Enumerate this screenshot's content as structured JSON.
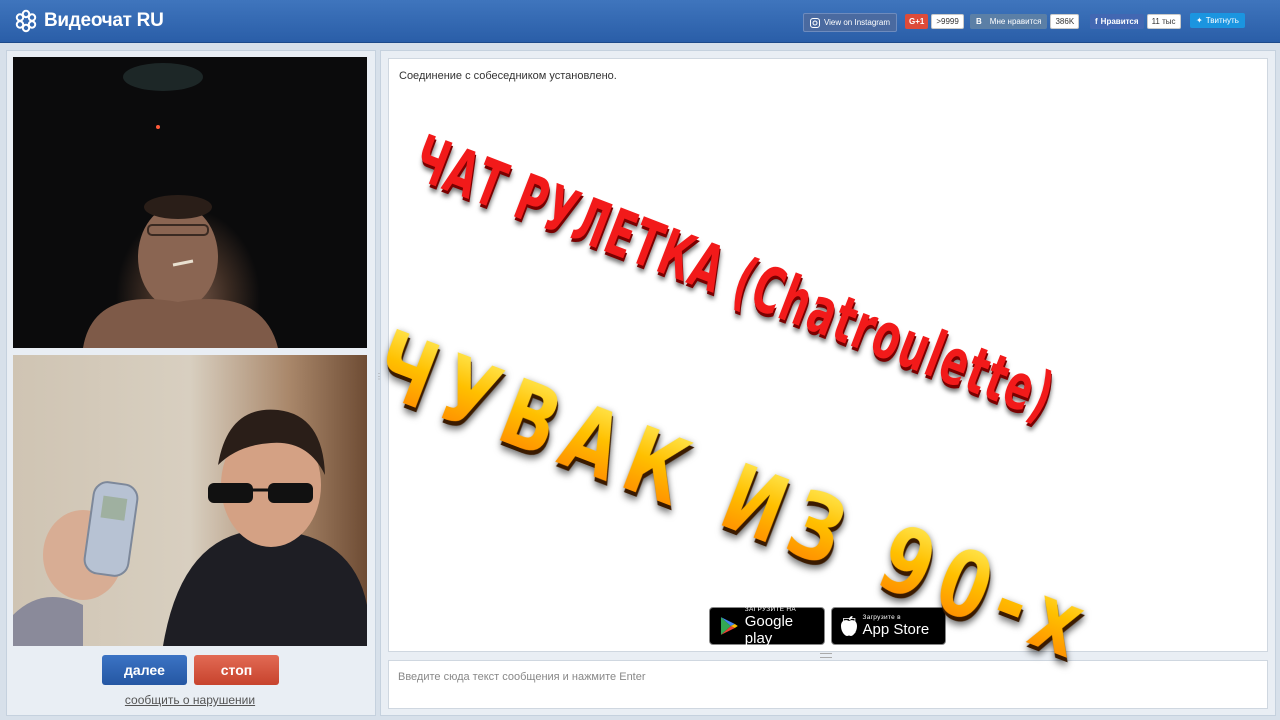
{
  "header": {
    "logo_text": "Видеочат RU",
    "instagram_label": "View on Instagram",
    "gplus_label": "G+1",
    "gplus_count": ">9999",
    "vk_label": "Мне нравится",
    "vk_count": "386K",
    "fb_label": "Нравится",
    "fb_count": "11 тыс",
    "twitter_label": "Твитнуть"
  },
  "controls": {
    "next_label": "далее",
    "stop_label": "стоп",
    "report_label": "сообщить о нарушении"
  },
  "chat": {
    "status_message": "Соединение с собеседником установлено.",
    "input_placeholder": "Введите сюда текст сообщения и нажмите Enter"
  },
  "stores": {
    "google_small": "ЗАГРУЗИТЕ НА",
    "google_big": "Google play",
    "apple_small": "Загрузите в",
    "apple_big": "App Store"
  },
  "overlay": {
    "line1": "ЧАТ РУЛЕТКА (Chatroulette)",
    "line2": "ЧУВАК ИЗ 90-х"
  },
  "colors": {
    "header": "#2f66b0",
    "next_button": "#2f64b5",
    "stop_button": "#d4533d",
    "overlay_red": "#f21a1a",
    "overlay_yellow": "#ffc000"
  }
}
